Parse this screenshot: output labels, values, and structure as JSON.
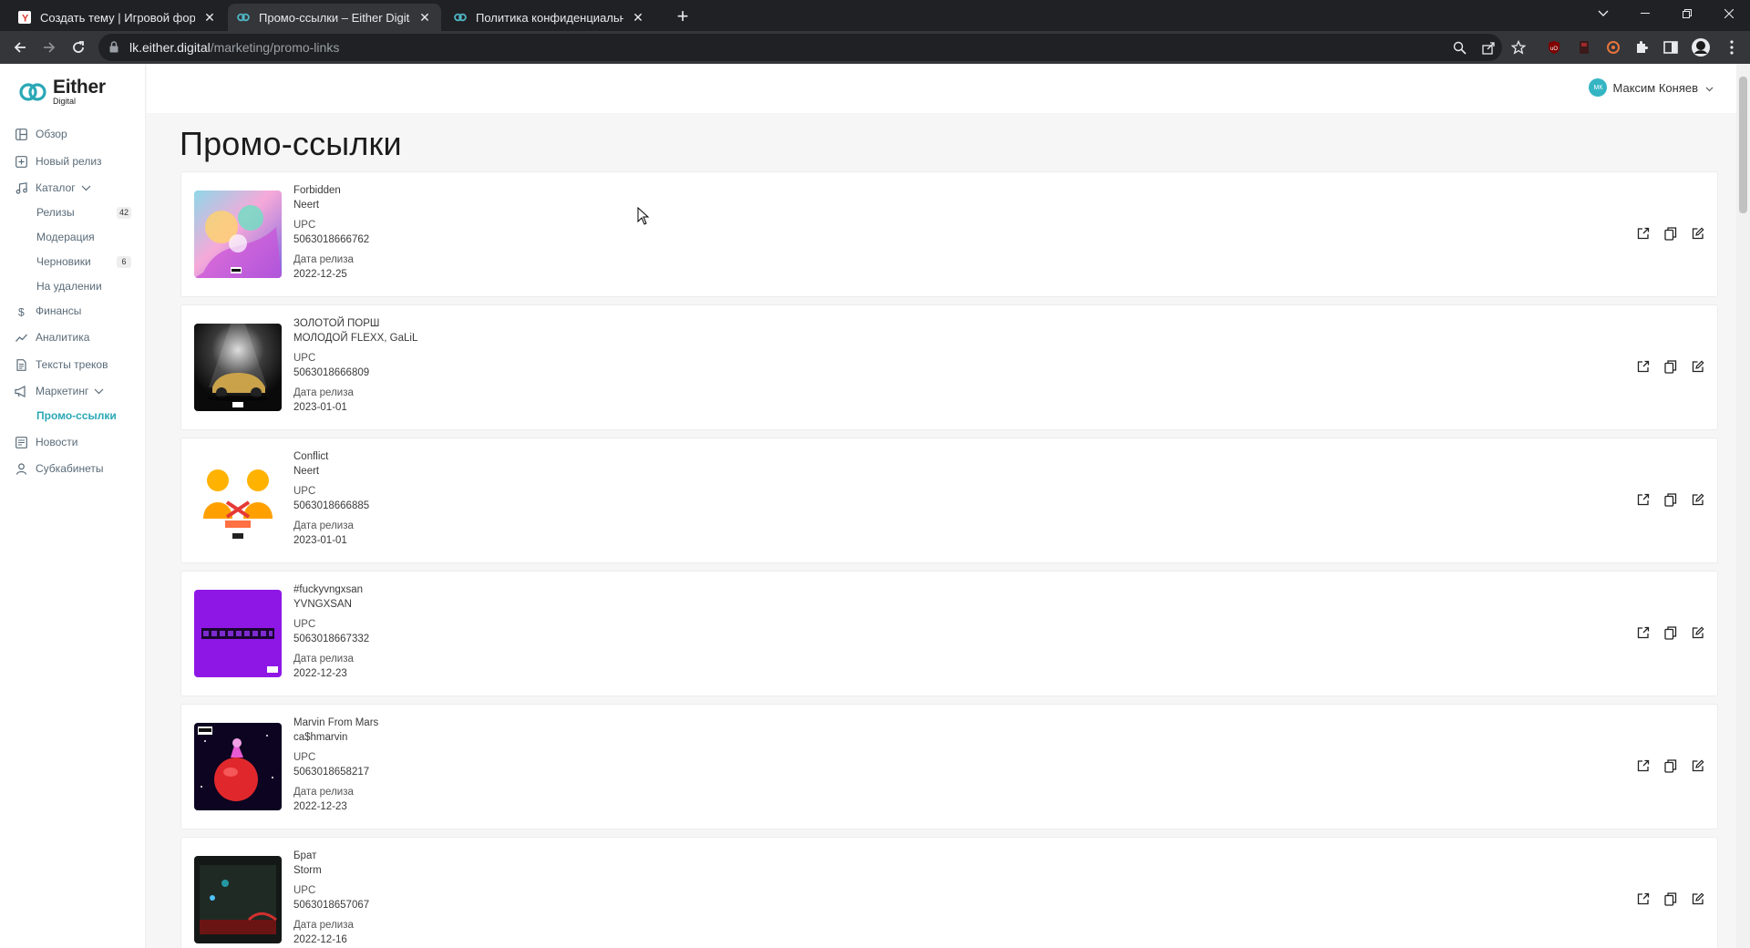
{
  "browser": {
    "tabs": [
      {
        "title": "Создать тему | Игровой форум",
        "favicon": "yandex-icon"
      },
      {
        "title": "Промо-ссылки – Either Digital",
        "favicon": "either-icon"
      },
      {
        "title": "Политика конфиденциальности",
        "favicon": "either-icon"
      }
    ],
    "url_host": "lk.either.digital",
    "url_path": "/marketing/promo-links"
  },
  "brand": {
    "name": "Either",
    "sub": "Digital",
    "accent": "#2aa8b6"
  },
  "sidebar": {
    "items": [
      {
        "label": "Обзор",
        "icon": "overview-icon"
      },
      {
        "label": "Новый релиз",
        "icon": "new-release-icon"
      },
      {
        "label": "Каталог",
        "icon": "music-note-icon"
      },
      {
        "label": "Финансы",
        "icon": "dollar-icon"
      },
      {
        "label": "Аналитика",
        "icon": "chart-icon"
      },
      {
        "label": "Тексты треков",
        "icon": "document-icon"
      },
      {
        "label": "Маркетинг",
        "icon": "megaphone-icon"
      },
      {
        "label": "Новости",
        "icon": "news-icon"
      },
      {
        "label": "Субкабинеты",
        "icon": "person-icon"
      }
    ],
    "catalog_sub": [
      {
        "label": "Релизы",
        "count": "42"
      },
      {
        "label": "Модерация",
        "count": ""
      },
      {
        "label": "Черновики",
        "count": "6"
      },
      {
        "label": "На удалении",
        "count": ""
      }
    ],
    "marketing_sub": [
      {
        "label": "Промо-ссылки"
      }
    ]
  },
  "user": {
    "initials": "МК",
    "name": "Максим Коняев"
  },
  "page_title": "Промо-ссылки",
  "labels": {
    "upc": "UPC",
    "release_date": "Дата релиза"
  },
  "releases": [
    {
      "title": "Forbidden",
      "artist": "Neert",
      "upc": "5063018666762",
      "date": "2022-12-25"
    },
    {
      "title": "ЗОЛОТОЙ ПОРШ",
      "artist": "МОЛОДОЙ FLEXX, GaLiL",
      "upc": "5063018666809",
      "date": "2023-01-01"
    },
    {
      "title": "Conflict",
      "artist": "Neert",
      "upc": "5063018666885",
      "date": "2023-01-01"
    },
    {
      "title": "#fuckyvngxsan",
      "artist": "YVNGXSAN",
      "upc": "5063018667332",
      "date": "2022-12-23"
    },
    {
      "title": "Marvin From Mars",
      "artist": "ca$hmarvin",
      "upc": "5063018658217",
      "date": "2022-12-23"
    },
    {
      "title": "Брат",
      "artist": "Storm",
      "upc": "5063018657067",
      "date": "2022-12-16"
    }
  ]
}
